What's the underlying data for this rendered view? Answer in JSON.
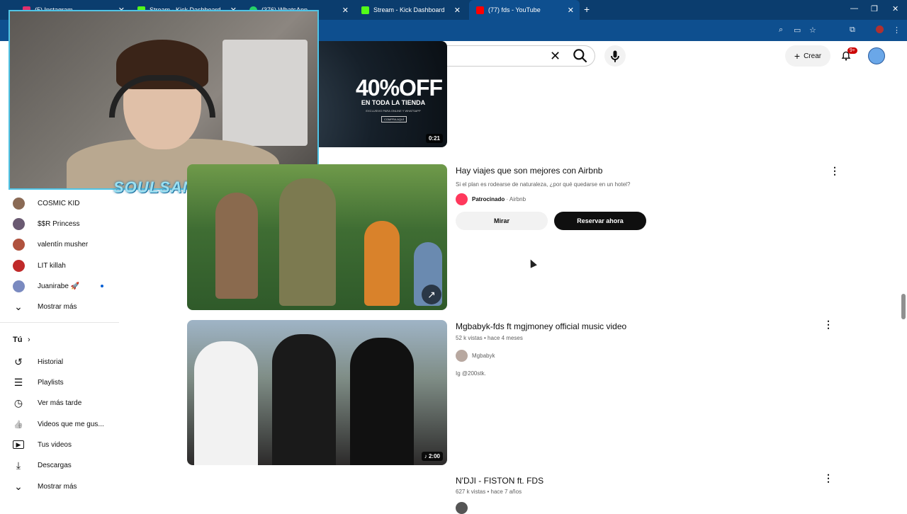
{
  "browser": {
    "tabs": [
      {
        "title": "(5) Instagram",
        "favicon_color": "#e1306c",
        "active": false
      },
      {
        "title": "Stream - Kick Dashboard",
        "favicon_color": "#53fc18",
        "active": false
      },
      {
        "title": "(376) WhatsApp",
        "favicon_color": "#25d366",
        "active": false
      },
      {
        "title": "Stream - Kick Dashboard",
        "favicon_color": "#53fc18",
        "active": false
      },
      {
        "title": "(77) fds - YouTube",
        "favicon_color": "#ff0000",
        "active": true
      }
    ],
    "new_tab_symbol": "+",
    "close_symbol": "✕"
  },
  "header": {
    "create_label": "Crear",
    "notifications_badge": "9+"
  },
  "overlay": {
    "logo_text": "SOULSANTA"
  },
  "sidebar": {
    "subscriptions": [
      {
        "name": "COSMIC KID",
        "avatar_color": "#8a6a55"
      },
      {
        "name": "$$R Princess",
        "avatar_color": "#6a5a72"
      },
      {
        "name": "valentín musher",
        "avatar_color": "#b0523e"
      },
      {
        "name": "LIT killah",
        "avatar_color": "#c02a2a"
      },
      {
        "name": "Juanirabe 🚀",
        "avatar_color": "#7a8ac0",
        "live": true
      }
    ],
    "show_more_label": "Mostrar más",
    "you_section": {
      "title": "Tú",
      "items": [
        {
          "label": "Historial",
          "icon": "history-icon",
          "glyph": "↺"
        },
        {
          "label": "Playlists",
          "icon": "playlist-icon",
          "glyph": "☰"
        },
        {
          "label": "Ver más tarde",
          "icon": "clock-icon",
          "glyph": "◷"
        },
        {
          "label": "Videos que me gus...",
          "icon": "thumbs-up-icon",
          "glyph": "👍"
        },
        {
          "label": "Tus videos",
          "icon": "video-icon",
          "glyph": "▶"
        },
        {
          "label": "Descargas",
          "icon": "download-icon",
          "glyph": "⤓"
        }
      ],
      "show_more_label": "Mostrar más"
    }
  },
  "results": [
    {
      "type": "ad-banner",
      "headline": "40%OFF",
      "subline": "EN TODA LA TIENDA",
      "small": "EXCLUSIVO PARA ONLINE Y WHATSAPP",
      "cta": "COMPRA AQUÍ",
      "duration": "0:21"
    },
    {
      "type": "sponsored",
      "title": "Hay viajes que son mejores con Airbnb",
      "description": "Si el plan es rodearse de naturaleza, ¿por qué quedarse en un hotel?",
      "sponsored_label": "Patrocinado",
      "advertiser": "Airbnb",
      "secondary_button": "Mirar",
      "primary_button": "Reservar ahora"
    },
    {
      "type": "video",
      "title": "Mgbabyk-fds ft mgjmoney official music video",
      "meta": "52 k vistas • hace 4 meses",
      "channel": "Mgbabyk",
      "description": "Ig @200stk.",
      "duration": "2:00"
    },
    {
      "type": "video",
      "title": "N'DJI - FISTON ft. FDS",
      "meta": "627 k vistas • hace 7 años"
    }
  ]
}
